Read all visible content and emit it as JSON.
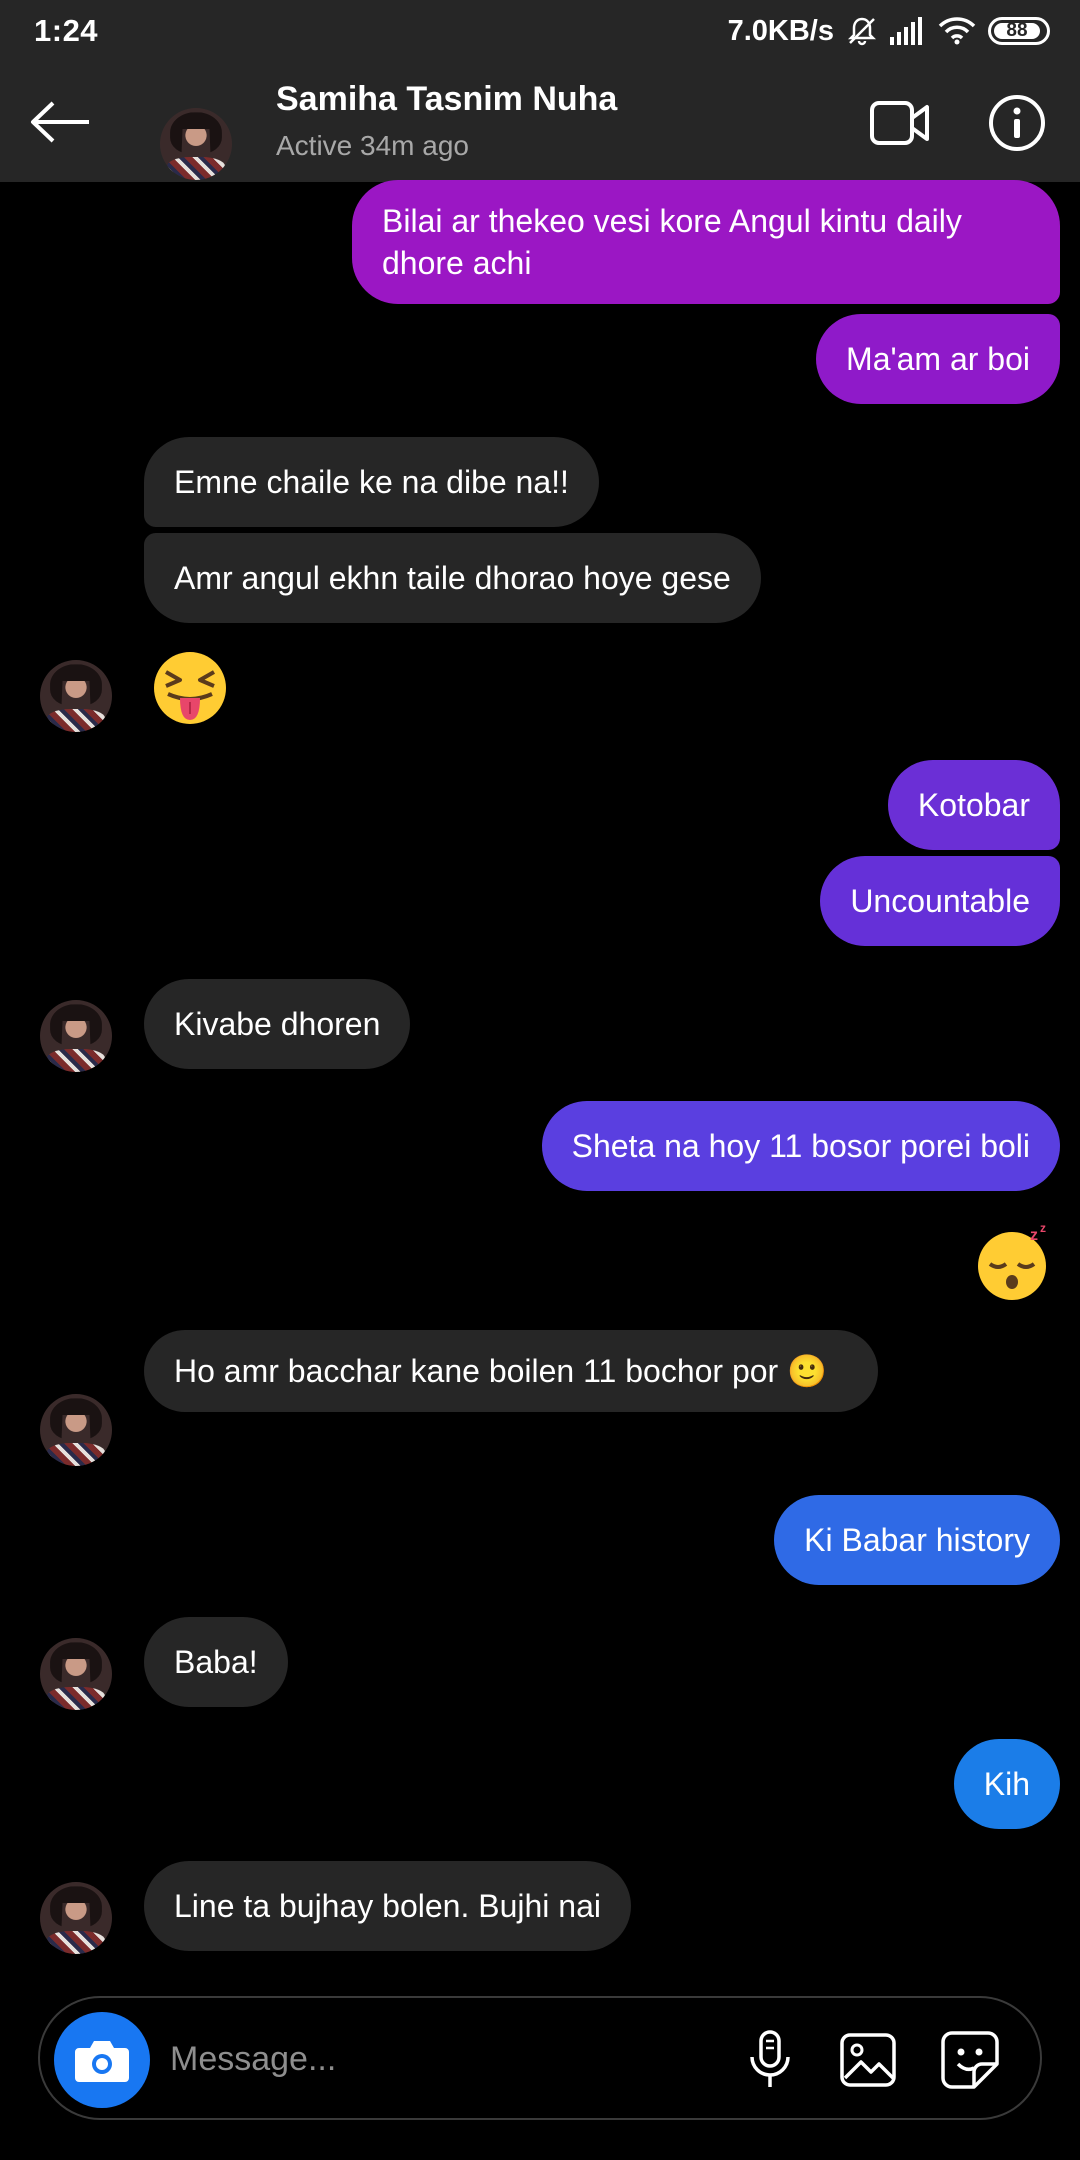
{
  "status_bar": {
    "time": "1:24",
    "speed": "7.0KB/s",
    "battery": "88"
  },
  "header": {
    "name": "Samiha Tasnim Nuha",
    "status": "Active 34m ago"
  },
  "messages": [
    {
      "from": "me",
      "text": "Bilai ar thekeo vesi kore Angul kintu daily dhore achi",
      "color": "#9b17c4"
    },
    {
      "from": "me",
      "text": "Ma'am ar boi",
      "color": "#8f1ac9"
    },
    {
      "from": "them",
      "text": "Emne chaile ke na dibe na!!"
    },
    {
      "from": "them",
      "text": "Amr angul ekhn taile dhorao hoye gese"
    },
    {
      "from": "them",
      "emoji": "😝"
    },
    {
      "from": "me",
      "text": "Kotobar",
      "color": "#6b2fd6"
    },
    {
      "from": "me",
      "text": "Uncountable",
      "color": "#6530d8"
    },
    {
      "from": "them",
      "text": "Kivabe dhoren"
    },
    {
      "from": "me",
      "text": "Sheta na hoy 11 bosor porei boli",
      "color": "#5a3fe0"
    },
    {
      "from": "me",
      "emoji": "😴"
    },
    {
      "from": "them",
      "text": "Ho amr bacchar kane boilen 11 bochor por 🙂"
    },
    {
      "from": "me",
      "text": "Ki Babar history",
      "color": "#2f6ae6"
    },
    {
      "from": "them",
      "text": "Baba!"
    },
    {
      "from": "me",
      "text": "Kih",
      "color": "#1b7de8"
    },
    {
      "from": "them",
      "text": "Line ta bujhay bolen. Bujhi nai"
    }
  ],
  "composer": {
    "placeholder": "Message..."
  },
  "icons": {
    "back": "arrow-left-icon",
    "video": "video-call-icon",
    "info": "info-icon",
    "camera": "camera-icon",
    "mic": "microphone-icon",
    "gallery": "image-icon",
    "sticker": "sticker-icon"
  },
  "colors": {
    "header_bg": "#262626",
    "incoming_bubble": "#262626",
    "camera_button": "#1877f2"
  }
}
